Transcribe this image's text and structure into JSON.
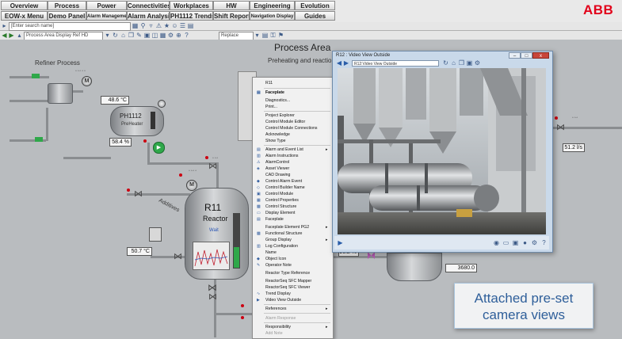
{
  "nav": {
    "row1": [
      "Overview",
      "Process",
      "Power",
      "Connectivities",
      "Workplaces",
      "HW",
      "Engineering",
      "Evolution"
    ],
    "row2": [
      "EOW-x Menu",
      "Demo Panel",
      "Alarm Management",
      "Alarm Analysis",
      "PH1112 Trends",
      "Shift Report",
      "Navigation Display",
      "Guides"
    ],
    "logo": "ABB"
  },
  "toolbar": {
    "search_placeholder": "[Enter search name]",
    "address": "Process Area Display Ref HD",
    "replace_label": "Replace"
  },
  "process": {
    "title": "Process Area",
    "subtitle": "Preheating and reaction tem",
    "refiner_label": "Refiner Process",
    "refiner_temp": "48.6 °C",
    "ph_tag": "PH1112",
    "ph_name": "PreHeater",
    "ph_level": "58.4 %",
    "reactor_tag": "R11",
    "reactor_name": "Reactor",
    "reactor_state": "Wait",
    "additives_label": "Additives",
    "feed_temp": "50.7 °C",
    "right_flow": "51.2 l/s",
    "right_pct": "96.2 %",
    "right_value": "3680.0",
    "motor_label": "M"
  },
  "menu": {
    "header": "R11",
    "items": [
      {
        "label": "Faceplate",
        "bold": true
      },
      {
        "label": "Diagnostics..."
      },
      {
        "label": "Print..."
      },
      {
        "label": "Project Explorer"
      },
      {
        "label": "Control Module Editor"
      },
      {
        "label": "Control Module Connections"
      },
      {
        "label": "Acknowledge"
      },
      {
        "label": "Show Type"
      },
      {
        "label": "Alarm and Event List",
        "sub": true
      },
      {
        "label": "Alarm Instructions"
      },
      {
        "label": "AlarmControl"
      },
      {
        "label": "Asset Viewer"
      },
      {
        "label": "CAD Drawing"
      },
      {
        "label": "Control Alarm Event"
      },
      {
        "label": "Control Builder Name"
      },
      {
        "label": "Control Module"
      },
      {
        "label": "Control Properties"
      },
      {
        "label": "Control Structure"
      },
      {
        "label": "Display Element"
      },
      {
        "label": "Faceplate"
      },
      {
        "label": "Faceplate Element PG2",
        "sub": true
      },
      {
        "label": "Functional Structure"
      },
      {
        "label": "Group Display",
        "sub": true
      },
      {
        "label": "Log Configuration"
      },
      {
        "label": "Name"
      },
      {
        "label": "Object Icon"
      },
      {
        "label": "Operator Note"
      },
      {
        "label": "Reactor Type Reference"
      },
      {
        "label": "ReactorSeq SFC Mapper"
      },
      {
        "label": "ReactorSeq SFC Viewer"
      },
      {
        "label": "Trend Display"
      },
      {
        "label": "Video View Outside"
      },
      {
        "label": "References",
        "sub": true
      },
      {
        "label": "Alarm Response",
        "disabled": true
      },
      {
        "label": "Responsibility",
        "sub": true
      },
      {
        "label": "Add Note",
        "disabled": true
      }
    ]
  },
  "video": {
    "title": "R12 : Video View Outside",
    "address": "R12:Video View Outside",
    "min": "–",
    "max": "□",
    "close": "x"
  },
  "callout": {
    "line1": "Attached pre-set",
    "line2": "camera views"
  },
  "colors": {
    "canvas": "#b9bcbf",
    "abb_red": "#e2001a",
    "callout_text": "#2f5f9a",
    "level_green": "#2fa84a",
    "alarm_red": "#cc0011"
  }
}
